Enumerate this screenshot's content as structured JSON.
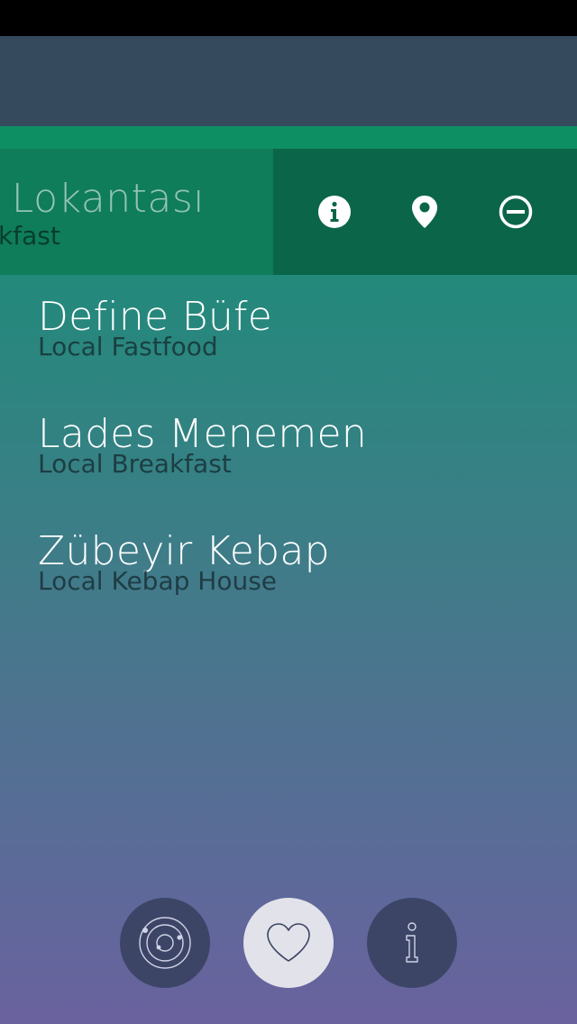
{
  "swiped_item": {
    "title": "n Lokantası",
    "subtitle": "kfast"
  },
  "actions": [
    {
      "icon": "info-icon"
    },
    {
      "icon": "location-pin-icon"
    },
    {
      "icon": "remove-icon"
    }
  ],
  "list": [
    {
      "title": "Define Büfe",
      "subtitle": "Local Fastfood"
    },
    {
      "title": "Lades Menemen",
      "subtitle": "Local Breakfast"
    },
    {
      "title": "Zübeyir Kebap",
      "subtitle": "Local Kebap House"
    }
  ],
  "tabs": [
    {
      "icon": "orbit-icon",
      "selected": false
    },
    {
      "icon": "heart-icon",
      "selected": true
    },
    {
      "icon": "info-outline-icon",
      "selected": false
    }
  ],
  "colors": {
    "header": "#364a5e",
    "accent": "#0e8f63",
    "action_panel": "#0b6649"
  }
}
